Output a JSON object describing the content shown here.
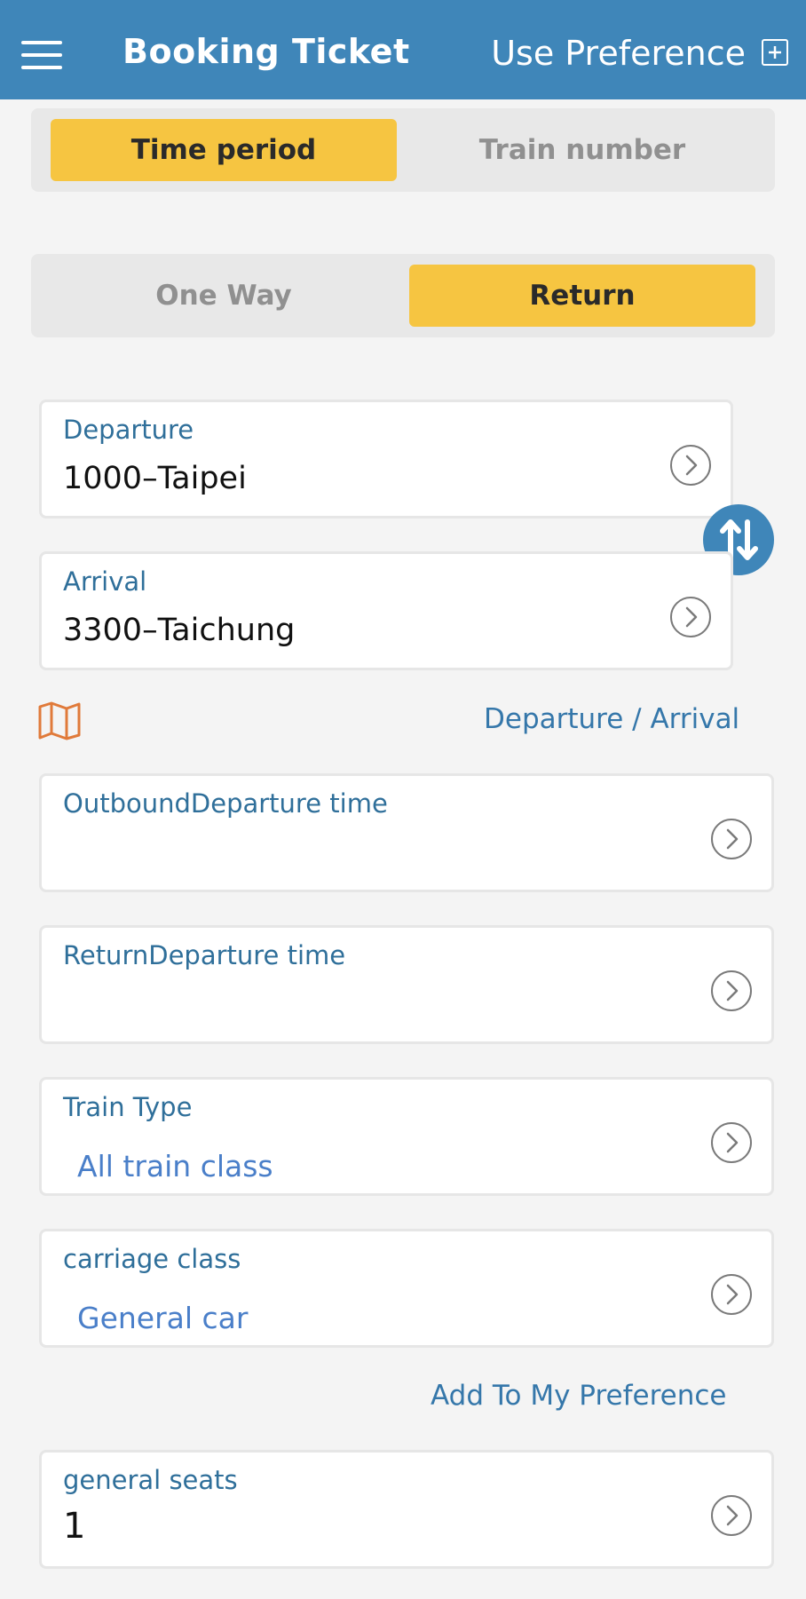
{
  "header": {
    "title": "Booking Ticket",
    "preference_label": "Use Preference"
  },
  "search_mode": {
    "options": [
      "Time period",
      "Train number"
    ],
    "selected": "Time period"
  },
  "trip_type": {
    "options": [
      "One Way",
      "Return"
    ],
    "selected": "Return"
  },
  "departure": {
    "label": "Departure",
    "value": "1000–Taipei"
  },
  "arrival": {
    "label": "Arrival",
    "value": "3300–Taichung"
  },
  "station_link": "Departure / Arrival",
  "outbound_time": {
    "label": "OutboundDeparture time",
    "value": ""
  },
  "return_time": {
    "label": "ReturnDeparture time",
    "value": ""
  },
  "train_type": {
    "label": "Train Type",
    "value": "All train class"
  },
  "carriage_class": {
    "label": "carriage class",
    "value": "General car"
  },
  "add_preference": "Add To My Preference",
  "general_seats": {
    "label": "general seats",
    "value": "1"
  },
  "colors": {
    "header": "#3f86b9",
    "accent": "#f6c541",
    "label": "#2f6f9a",
    "link": "#4a7fc9",
    "map_icon": "#e07a3a"
  }
}
